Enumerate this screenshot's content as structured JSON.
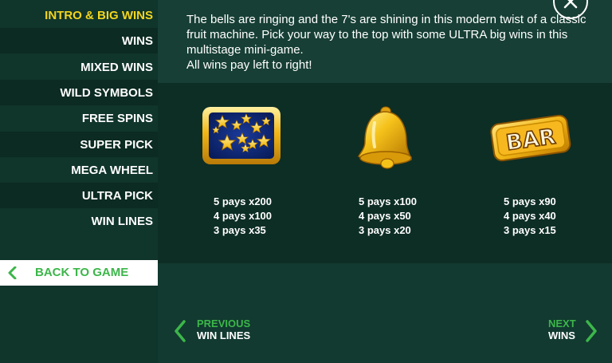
{
  "sidebar": {
    "items": [
      {
        "label": "INTRO & BIG WINS"
      },
      {
        "label": "WINS"
      },
      {
        "label": "MIXED WINS"
      },
      {
        "label": "WILD SYMBOLS"
      },
      {
        "label": "FREE SPINS"
      },
      {
        "label": "SUPER PICK"
      },
      {
        "label": "MEGA WHEEL"
      },
      {
        "label": "ULTRA PICK"
      },
      {
        "label": "WIN LINES"
      }
    ],
    "back_label": "BACK TO GAME"
  },
  "intro": {
    "line1": "The bells are ringing and the 7's are shining in this modern twist of a classic fruit machine. Pick your way to the top with some ULTRA big wins in this multistage mini-game.",
    "line2": "All wins pay left to right!"
  },
  "symbols": [
    {
      "icon": "stars-symbol-icon",
      "pays": [
        "5 pays x200",
        "4 pays x100",
        "3 pays x35"
      ]
    },
    {
      "icon": "bell-symbol-icon",
      "pays": [
        "5 pays x100",
        "4 pays x50",
        "3 pays x20"
      ]
    },
    {
      "icon": "bar-symbol-icon",
      "bar_text": "BAR",
      "pays": [
        "5 pays x90",
        "4 pays x40",
        "3 pays x15"
      ]
    }
  ],
  "nav": {
    "prev_small": "PREVIOUS",
    "prev_big": "WIN LINES",
    "next_small": "NEXT",
    "next_big": "WINS"
  },
  "colors": {
    "accent_green": "#3cb64a",
    "active_yellow": "#f3d51e",
    "gold": "#f2b616"
  }
}
